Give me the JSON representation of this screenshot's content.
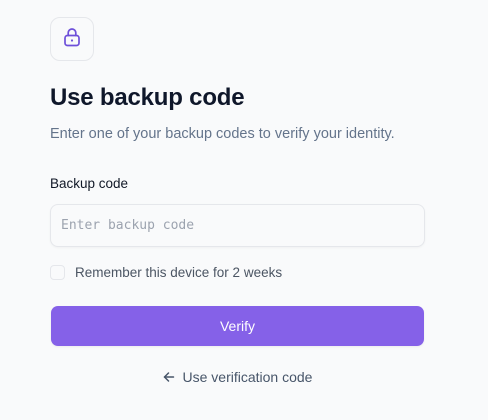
{
  "header": {
    "icon": "lock-icon",
    "title": "Use backup code",
    "subtitle": "Enter one of your backup codes to verify your identity."
  },
  "form": {
    "backup_code_label": "Backup code",
    "backup_code_placeholder": "Enter backup code",
    "backup_code_value": "",
    "remember_label": "Remember this device for 2 weeks",
    "remember_checked": false,
    "verify_label": "Verify"
  },
  "footer": {
    "back_icon": "arrow-left-icon",
    "back_link_label": "Use verification code"
  },
  "colors": {
    "accent": "#8561e8",
    "icon_accent": "#6d4fd9",
    "title": "#0f172a",
    "muted_text": "#64748b",
    "background": "#f9fafb"
  }
}
